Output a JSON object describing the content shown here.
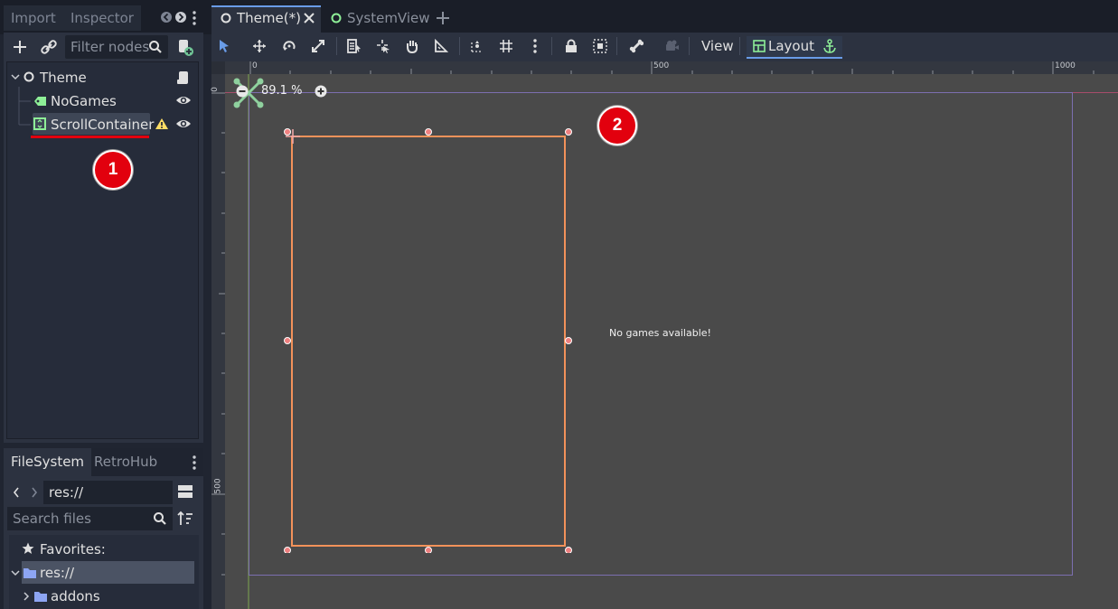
{
  "left_dock": {
    "tabs": [
      "Import",
      "Inspector"
    ],
    "filter_placeholder": "Filter nodes"
  },
  "scene_tree": {
    "nodes": [
      {
        "label": "Theme"
      },
      {
        "label": "NoGames"
      },
      {
        "label": "ScrollContainer"
      }
    ]
  },
  "filesystem": {
    "tabs": [
      "FileSystem",
      "RetroHub"
    ],
    "path": "res://",
    "search_placeholder": "Search files",
    "favorites_label": "Favorites:",
    "items": [
      "res://",
      "addons"
    ]
  },
  "scene_tabs": [
    "Theme(*)",
    "SystemView"
  ],
  "toolbar": {
    "view_label": "View",
    "layout_label": "Layout"
  },
  "viewport": {
    "zoom": "89.1 %",
    "ruler_top": [
      "0",
      "500",
      "1000"
    ],
    "ruler_left": [
      "0",
      "500"
    ],
    "canvas_text": "No games available!"
  },
  "annotations": [
    "1",
    "2"
  ],
  "colors": {
    "accent": "#699ce8",
    "selection": "#f3925a",
    "annotation": "#e2000e"
  }
}
